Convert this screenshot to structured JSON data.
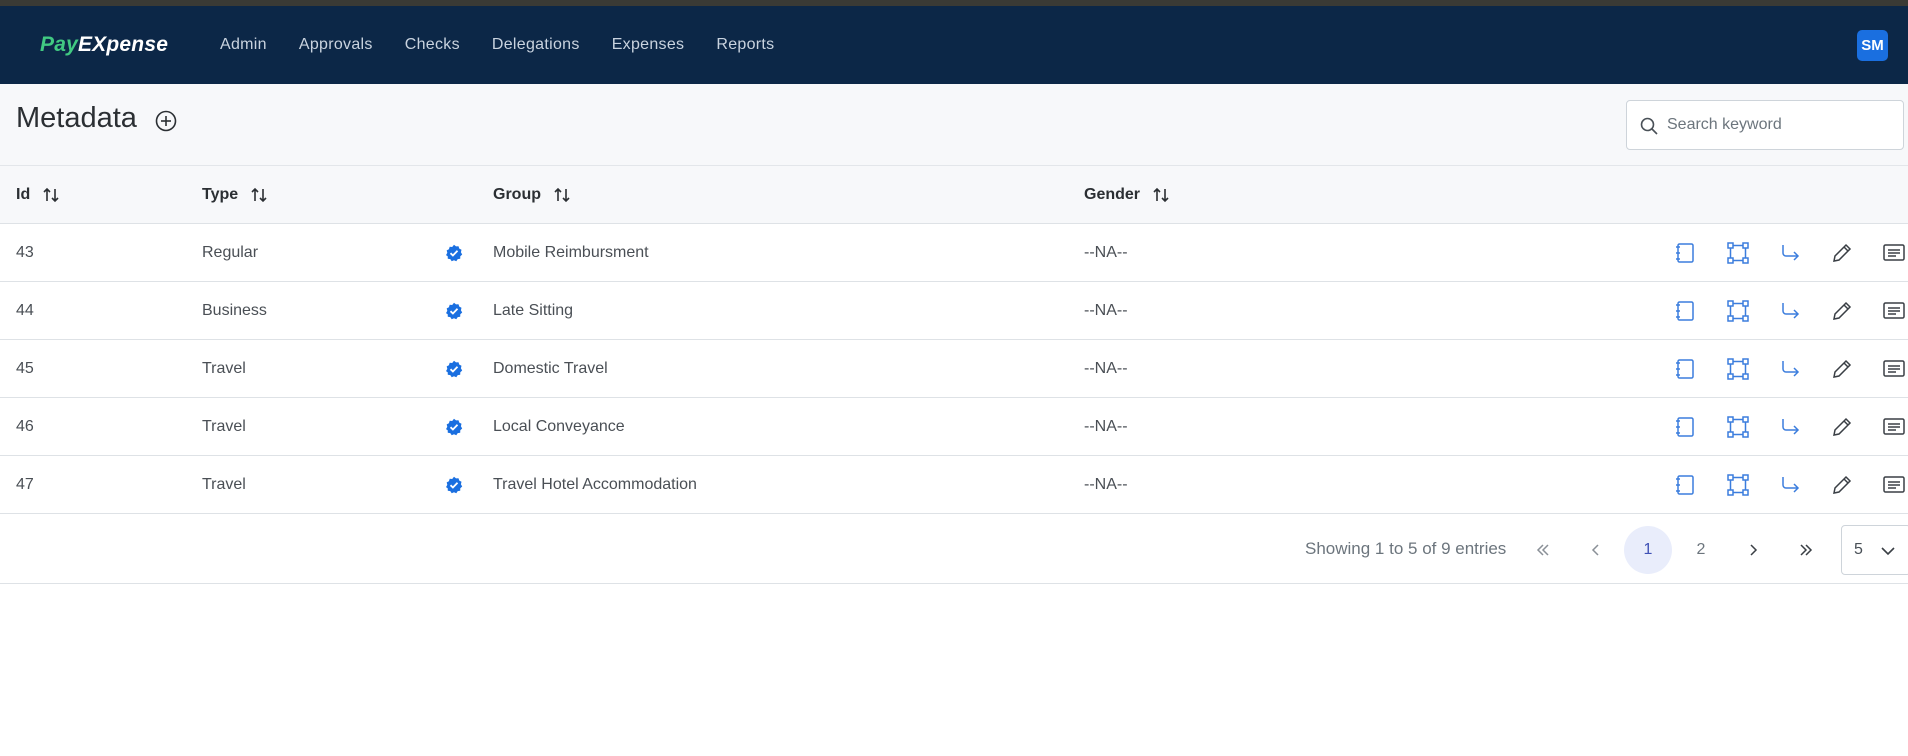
{
  "brand": {
    "part1": "Pay",
    "part2": "EXpense"
  },
  "nav": {
    "items": [
      {
        "label": "Admin"
      },
      {
        "label": "Approvals"
      },
      {
        "label": "Checks"
      },
      {
        "label": "Delegations"
      },
      {
        "label": "Expenses"
      },
      {
        "label": "Reports"
      }
    ]
  },
  "user": {
    "initials": "SM"
  },
  "page": {
    "title": "Metadata"
  },
  "search": {
    "placeholder": "Search keyword",
    "value": ""
  },
  "table": {
    "headers": {
      "id": "Id",
      "type": "Type",
      "group": "Group",
      "gender": "Gender"
    },
    "rows": [
      {
        "id": "43",
        "type": "Regular",
        "group": "Mobile Reimbursment",
        "gender": "--NA--"
      },
      {
        "id": "44",
        "type": "Business",
        "group": "Late Sitting",
        "gender": "--NA--"
      },
      {
        "id": "45",
        "type": "Travel",
        "group": "Domestic Travel",
        "gender": "--NA--"
      },
      {
        "id": "46",
        "type": "Travel",
        "group": "Local Conveyance",
        "gender": "--NA--"
      },
      {
        "id": "47",
        "type": "Travel",
        "group": "Travel Hotel Accommodation",
        "gender": "--NA--"
      }
    ],
    "row_icons": [
      "verified-badge-icon",
      "notebook-icon",
      "nodes-icon",
      "redirect-arrow-icon",
      "pencil-icon",
      "comment-icon"
    ]
  },
  "pagination": {
    "summary": "Showing 1 to 5 of 9 entries",
    "pages": [
      "1",
      "2"
    ],
    "current": "1",
    "page_size": "5"
  },
  "colors": {
    "navbar": "#0c2747",
    "brand_green": "#41c982",
    "accent_blue": "#1a6fe0",
    "icon_blue": "#3b7ddd",
    "active_page_bg": "#e9edfb"
  }
}
